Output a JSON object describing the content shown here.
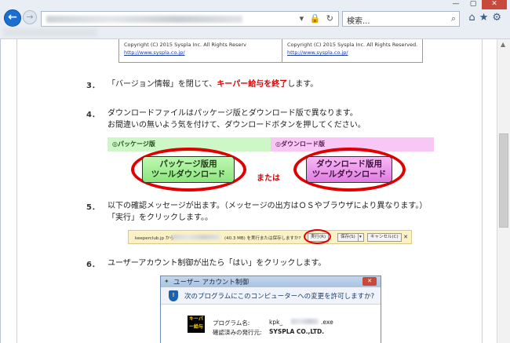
{
  "browser": {
    "search_placeholder": "検索...",
    "address_icons": "▾ 🔒 ↻",
    "win_min": "—",
    "win_max": "▢",
    "win_close": "✕",
    "back_label": "←",
    "forward_label": "→"
  },
  "copyright_boxes": [
    {
      "line1": "Copyright (C) 2015 Syspla Inc. All Rights Reserv",
      "link": "http://www.syspla.co.jp/"
    },
    {
      "line1": "Copyright (C) 2015 Syspla Inc. All Rights Reserved.",
      "link": "http://www.syspla.co.jp/"
    }
  ],
  "steps": {
    "step3": {
      "num": "3．",
      "text_before": "「バージョン情報」を閉じて、",
      "highlight": "キーパー給与を終了",
      "text_after": "します。"
    },
    "step4": {
      "num": "4．",
      "line1": "ダウンロードファイルはパッケージ版とダウンロード版で異なります。",
      "line2": "お間違いの無いよう気を付けて、ダウンロードボタンを押してください。"
    },
    "step5": {
      "num": "5．",
      "line1": "以下の確認メッセージが出ます。（メッセージの出方はＯＳやブラウザにより異なります。）",
      "line2": "「実行」をクリックします。。"
    },
    "step6": {
      "num": "6．",
      "line1": "ユーザーアカウント制御が出たら「はい」をクリックします。"
    }
  },
  "download_table": {
    "package_header": "◎パッケージ版",
    "download_header": "◎ダウンロード版",
    "package_button_line1": "パッケージ版用",
    "package_button_line2": "ツールダウンロード",
    "download_button_line1": "ダウンロード版用",
    "download_button_line2": "ツールダウンロード",
    "or_text": "または"
  },
  "ie_notification": {
    "site": "keeperclub.jp から",
    "size_text": "(40.3 MB) を実行または保存しますか?",
    "run_label": "実行(R)",
    "save_label": "保存(S)",
    "cancel_label": "キャンセル(C)",
    "close_label": "✕"
  },
  "uac_dialog": {
    "title": "ユーザー アカウント制御",
    "question": "次のプログラムにこのコンピューターへの変更を許可しますか?",
    "program_label": "プログラム名:",
    "program_prefix": "kpk_",
    "program_suffix": ".exe",
    "publisher_label": "確認済みの発行元:",
    "publisher_value": "SYSPLA CO.,LTD.",
    "logo_text": "キーパー給与"
  },
  "colors": {
    "accent_red": "#e00000",
    "package_green": "#cdf7c6",
    "download_pink": "#f9c7f5",
    "link_blue": "#1a3aa8"
  }
}
